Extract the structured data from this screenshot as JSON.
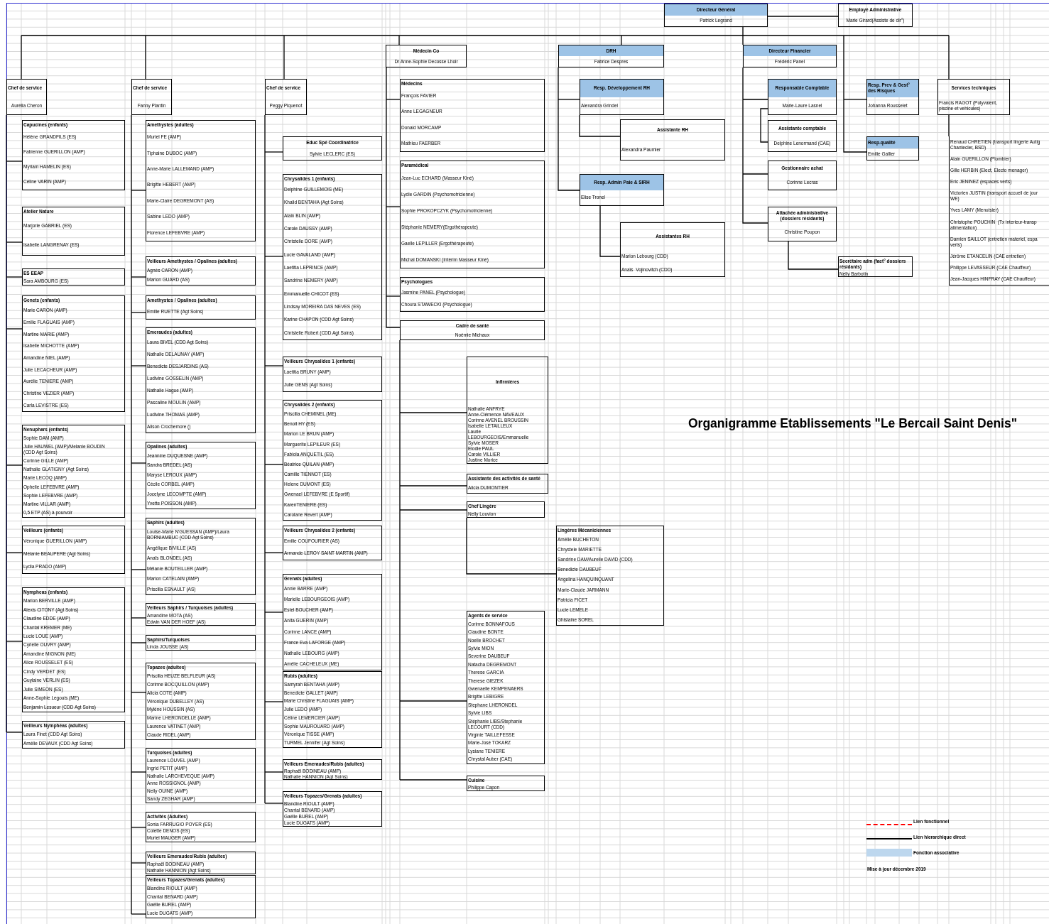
{
  "title": "Organigramme Etablissements \"Le Bercail Saint Denis\"",
  "header": [
    {
      "kind": "post",
      "title": "Directeur Général",
      "associative": true,
      "members": [
        "Patrick Legrand"
      ]
    },
    {
      "kind": "post",
      "title": "Employé Administrative",
      "associative": false,
      "members": [
        "Marie Girard(Assiste de dir°)"
      ]
    }
  ],
  "columns": [
    {
      "boxes": [
        {
          "kind": "chief",
          "title": "Chef de service",
          "associative": false,
          "members": [
            "Aurélia Cheron"
          ]
        },
        {
          "kind": "team",
          "title": "Capucines (enfants)",
          "associative": false,
          "members": [
            "Hélène GRANDFILS (ES)",
            "Fabienne GUERILLON (AMP)",
            "Myriam HAMELIN (ES)",
            "Céline VARIN (AMP)"
          ]
        },
        {
          "kind": "team",
          "title": "Atelier Nature",
          "associative": false,
          "members": [
            "Marjorie GABRIEL (ES)",
            "Isabelle LANGRENAY (ES)"
          ]
        },
        {
          "kind": "team",
          "title": "ES EEAP",
          "associative": false,
          "members": [
            "Sara AMBOURG (ES)"
          ]
        },
        {
          "kind": "team",
          "title": "Genets (enfants)",
          "associative": false,
          "members": [
            "Marie CARON (AMP)",
            "Emilie FLAGUAIS (AMP)",
            "Martine MARIE (AMP)",
            "Isabelle MICHOTTE (AMP)",
            "Amandine NIEL (AMP)",
            "Julie LECACHEUR (AMP)",
            "Aurélie TENIERE (AMP)",
            "Christine VEZIER (AMP)",
            "Carla LEVISTRE (ES)"
          ]
        },
        {
          "kind": "team",
          "title": "Nenuphars (enfants)",
          "associative": false,
          "members": [
            "Sophie DAM (AMP)",
            "Julie HAUWEL (AMP)/Melanie BOUDIN\n(CDD Agt Soins)",
            "Corinne GILLE (AMP)",
            "Nathalie GLATIGNY (Agt Soins)",
            "Marie LECOQ (AMP)",
            "Ophelie LEFEBVRE (AMP)",
            "Sophie LEFEBVRE (AMP)",
            "Martine VILLAR (AMP)",
            "0,5 ETP (AS) à pourvoir"
          ]
        },
        {
          "kind": "team",
          "title": "Veilleurs (enfants)",
          "associative": false,
          "members": [
            "Véronique GUERILLON (AMP)",
            "Mélanie BEAUPERE (Agt Soins)",
            "Lydia PRADO (AMP)"
          ]
        },
        {
          "kind": "team",
          "title": "Nympheas (enfants)",
          "associative": false,
          "members": [
            "Marion BERVILLE (AMP)",
            "Alexis CITONY (Agt Soins)",
            "Claudine EDDE (AMP)",
            "Chantal KREMER (ME)",
            "Lucie LOUE (AMP)",
            "Cyrielle OUVRY (AMP)",
            "Amandine MIGNON (ME)",
            "Alice ROUSSELET (ES)",
            "Cindy VERDET (ES)",
            "Guylaine VERLIN (ES)",
            "Julie SIMEON (ES)",
            "Anne-Sophie Legouis (ME)",
            "Benjamin Lesueur (CDD Agt Soins)"
          ]
        },
        {
          "kind": "team",
          "title": "Veilleurs Nymphéas (adultes)",
          "associative": false,
          "members": [
            "Laura Finet (CDD Agt Soins)",
            "Amélie DEVAUX (CDD Agt Soins)"
          ]
        }
      ]
    },
    {
      "boxes": [
        {
          "kind": "chief",
          "title": "Chef de service",
          "associative": false,
          "members": [
            "Fanny Plantin"
          ]
        },
        {
          "kind": "team",
          "title": "Amethystes (adultes)",
          "associative": false,
          "members": [
            "Muriel FE (AMP)",
            "Tiphaine DUBOC (AMP)",
            "Anne-Marie LALLEMAND (AMP)",
            "Brigitte HEBERT (AMP)",
            "Marie-Claire DEGREMONT (AS)",
            "Sabine LEDO (AMP)",
            "Florence LEFEBVRE (AMP)"
          ]
        },
        {
          "kind": "team",
          "title": "Veilleurs Amethystes / Opalines (adultes)",
          "associative": false,
          "members": [
            "Agnès CARON (AMP)",
            "Marion GUARD (AS)"
          ]
        },
        {
          "kind": "team",
          "title": "Amethystes / Opalines (adultes)",
          "associative": false,
          "members": [
            "Emilie RUETTE (Agt Soins)"
          ]
        },
        {
          "kind": "team",
          "title": "Emeraudes (adultes)",
          "associative": false,
          "members": [
            "Laura BIVEL (CDD Agt Soins)",
            "Nathalie DELAUNAY (AMP)",
            "Benedicte DESJARDINS (AS)",
            "Ludivine GOSSELIN (AMP)",
            "Nathalie Hague (AMP)",
            "Pascaline MOULIN (AMP)",
            "Ludivine THOMAS (AMP)",
            "Alison Crochemore ()"
          ]
        },
        {
          "kind": "team",
          "title": "Opalines (adultes)",
          "associative": false,
          "members": [
            "Jeannine DUQUESNE (AMP)",
            "Sandra BREDEL (AS)",
            "Maryse LEROUX (AMP)",
            "Cécile CORBEL (AMP)",
            "Jocelyne LECOMPTE (AMP)",
            "Yvette POISSON (AMP)"
          ]
        },
        {
          "kind": "team",
          "title": "Saphirs (adultes)",
          "associative": false,
          "members": [
            "Louise-Marie N'GUESSAN (AMP)/Laura\nBORNIAMBUC (CDD Agt Soins)",
            "Angélique BIVILLE (AS)",
            "Anaïs BLONDEL (AS)",
            "Mélanie BOUTEILLER (AMP)",
            "Marion CATELAIN (AMP)",
            "Priscilla ESNAULT (AS)"
          ]
        },
        {
          "kind": "team",
          "title": "Veilleurs Saphirs / Turquoises (adultes)",
          "associative": false,
          "members": [
            "Amandine MOTA (AS)",
            "Edwin VAN DER HOEF (AS)"
          ]
        },
        {
          "kind": "team",
          "title": "Saphirs/Turquoises",
          "associative": false,
          "members": [
            "Linda JOUSSE (AS)"
          ]
        },
        {
          "kind": "team",
          "title": "Topazes (adultes)",
          "associative": false,
          "members": [
            "Priscilla HEUZE BELFLEUR (AS)",
            "Corinne BOCQUILLON (AMP)",
            "Alicia COTE (AMP)",
            "Véronique DUBELLEY (AS)",
            "Mylène HOUSSIN (AS)",
            "Marine LHERONDELLE (AMP)",
            "Laurence VATINET (AMP)",
            "Claude RIDEL (AMP)"
          ]
        },
        {
          "kind": "team",
          "title": "Turquoises (adultes)",
          "associative": false,
          "members": [
            "Laurence LOUVEL (AMP)",
            "Ingrid PETIT (AMP)",
            "Nathalie LARCHEVEQUE (AMP)",
            "Anne ROSSIGNOL (AMP)",
            "Nelly OUINE (AMP)",
            "Sandy ZEGHAR (AMP)"
          ]
        },
        {
          "kind": "team",
          "title": "Activités (Adultes)",
          "associative": false,
          "members": [
            "Sonia FARRUGIO POYER (ES)",
            "Colette DENOS (ES)",
            "Muriel MAUGER (AMP)"
          ]
        },
        {
          "kind": "team",
          "title": "Veilleurs Emeraudes/Rubis (adultes)",
          "associative": false,
          "members": [
            "Raphaël BODINEAU (AMP)",
            "Nathalie HANNION (Agt Soins)"
          ]
        },
        {
          "kind": "team",
          "title": "Veilleurs Topazes/Grenats (adultes)",
          "associative": false,
          "members": [
            "Blandine RIOULT (AMP)",
            "Chantal BENARD (AMP)",
            "Gaëlle BUREL (AMP)",
            "Lucie DUGATS (AMP)"
          ]
        }
      ]
    },
    {
      "boxes": [
        {
          "kind": "chief",
          "title": "Chef de service",
          "associative": false,
          "members": [
            "Peggy Piquenot"
          ]
        },
        {
          "kind": "post",
          "title": "Educ Spé Coordinatrice",
          "associative": false,
          "members": [
            "Sylvie LECLERC (ES)"
          ]
        },
        {
          "kind": "team",
          "title": "Chrysalides 1 (enfants)",
          "associative": false,
          "members": [
            "Delphine GUILLEMOIS (ME)",
            "Khalid BENTAHA (Agt Soins)",
            "Alain BLIN (AMP)",
            "Carole DAUSSY (AMP)",
            "Christelle DORE (AMP)",
            "Lucie GAVALAND (AMP)",
            "Laetitia LEPRINCE (AMP)",
            "Sandrine NEMERY (AMP)",
            "Emmanuelle CHICOT (ES)",
            "Lindsay MOREIRA DAS NEVES (ES)",
            "Karine CHAPON (CDD Agt Soins)",
            "Christelle Robert (CDD Agt Soins)"
          ]
        },
        {
          "kind": "team",
          "title": "Veilleurs Chrysalides 1 (enfants)",
          "associative": false,
          "members": [
            "Laetitia BRUNY (AMP)",
            "Julie GENS (Agt Soins)"
          ]
        },
        {
          "kind": "team",
          "title": "Chrysalides 2 (enfants)",
          "associative": false,
          "members": [
            "Priscilla CHEMINEL (ME)",
            "Benoit HY (ES)",
            "Marion LE BRUN (AMP)",
            "Marguerite LEPILEUR (ES)",
            "Fabiola ANQUETIL (ES)",
            "Béatrice QUILAN (AMP)",
            "Camille TIENNOT (ES)",
            "Helene DUMONT (ES)",
            "Gwenael LEFEBVRE (E Sportif)",
            "KarenTENIERE (ES)",
            "Carolane Revert (AMP)"
          ]
        },
        {
          "kind": "team",
          "title": "Veilleurs Chrysalides 2 (enfants)",
          "associative": false,
          "members": [
            "Emilie COUFOURIER (AS)",
            "Armande LEROY SAINT MARTIN (AMP)"
          ]
        },
        {
          "kind": "team",
          "title": "Grenats (adultes)",
          "associative": false,
          "members": [
            "Annie BARRE (AMP)",
            "Marielle LEBOURGEOIS (AMP)",
            "Estel BOUCHER (AMP)",
            "Anita GUERIN (AMP)",
            "Corinne LANCE (AMP)",
            "France Eva LAFORGE (AMP)",
            "Nathalie LEBOURG (AMP)",
            "Amélie CACHELEUX (ME)"
          ]
        },
        {
          "kind": "team",
          "title": "Rubis (adultes)",
          "associative": false,
          "members": [
            "Samyrah BENTAHA (AMP)",
            "Benedicte GALLET (AMP)",
            "Marie Christine FLAGUAIS (AMP)",
            "Julie LEDO (AMP)",
            "Céline LEMERCIER (AMP)",
            "Sophie MAUROUARD (AMP)",
            "Véronique TISSE (AMP)",
            "TURMEL Jennifer (Agt Soins)"
          ]
        },
        {
          "kind": "team",
          "title": "Veilleurs Emeraudes/Rubis (adultes)",
          "associative": false,
          "members": [
            "Raphaël BODINEAU (AMP)",
            "Nathalie HANNION (Agt Soins)"
          ]
        },
        {
          "kind": "team",
          "title": "Veilleurs Topazes/Grenats (adultes)",
          "associative": false,
          "members": [
            "Blandine RIOULT (AMP)",
            "Chantal BENARD (AMP)",
            "Gaëlle BUREL (AMP)",
            "Lucie DUGATS (AMP)"
          ]
        }
      ]
    },
    {
      "boxes": [
        {
          "kind": "post",
          "title": "Médecin Co",
          "associative": false,
          "members": [
            "Dr Anne-Sophie Decosse Lhoir"
          ]
        },
        {
          "kind": "team",
          "title": "Médecins",
          "associative": false,
          "members": [
            "François FAVIER",
            "Anne LEGAGNEUR",
            "Donald MORCAMP",
            "Mathieu FAERBER"
          ]
        },
        {
          "kind": "team",
          "title": "Paramédical",
          "associative": false,
          "members": [
            "Jean-Luc ECHARD (Masseur Kiné)",
            "Lydie GARDIN (Psychomotricienne)",
            "Sophie PROKOPCZYK (Psychomotricienne)",
            "Stéphanie NEMERY(Ergothérapeute)",
            "Gaelle LEPILLER (Ergothérapeute)",
            "Michal DOMANSKI (Intérim Masseur Kiné)"
          ]
        },
        {
          "kind": "team",
          "title": "Psychologues",
          "associative": false,
          "members": [
            "Jasmine PANEL (Psychologue)",
            "Choura STAWECKI (Psychologue)"
          ]
        },
        {
          "kind": "post",
          "title": "Cadre de santé",
          "associative": false,
          "members": [
            "Noémie Michaux"
          ]
        },
        {
          "kind": "unit",
          "title": "Infirmières",
          "associative": false,
          "members": [
            "Nathalie ANFRYE",
            "Anne-Clémence NAVEAUX",
            "Corinne AVENEL BROUSSIN",
            "Isabelle LETAILLEUX",
            "Laurie\nLEBOURGEOIS/Emmanuelle",
            "Sylvie MOSER",
            "Elodie PAUL",
            "Carole VILLIER",
            "Justine Morice"
          ]
        },
        {
          "kind": "team",
          "title": "Assistante des activités de santé",
          "associative": false,
          "members": [
            "Alicia DUMONTIER"
          ]
        },
        {
          "kind": "team",
          "title": "Chef Lingère",
          "associative": false,
          "members": [
            "Nelly Louvion"
          ]
        },
        {
          "kind": "team",
          "title": "Lingères Mécaniciennes",
          "associative": false,
          "members": [
            "Amélie BUCHETON",
            "Chrystele MARIETTE",
            "Sandrine DAM/Aurelie DAVID (CDD)",
            "Benedicte DAUBEUF",
            "Angelina HANQUINQUANT",
            "Marie-Claude JARMANN",
            "Patricia FICET",
            "Lucie LEMELE",
            "Ghislaine SOREL"
          ]
        },
        {
          "kind": "team",
          "title": "Agents de service",
          "associative": false,
          "members": [
            "Corinne BONNAFOUS",
            "Claudine BONTE",
            "Noelle BROCHET",
            "Sylvie MION",
            "Severine DAUBEUF",
            "Natacha DEGREMONT",
            "Therese GARCIA",
            "Therese GIEZEK",
            "Gwenaelle KEMPENAERS",
            "Brigitte LEBIGRE",
            "Stephane LHERONDEL",
            "Sylvie LIBS",
            "Stéphanie LIBS/Stephanie\nLECOURT (CDD)",
            "Virginie TAILLEFESSE",
            "Marie-José TOKARZ",
            "Lysiane TENIERE",
            "Chrystal Auber (CAE)"
          ]
        },
        {
          "kind": "team",
          "title": "Cuisine",
          "associative": false,
          "members": [
            "Philippe Capon"
          ]
        }
      ]
    },
    {
      "boxes": [
        {
          "kind": "post",
          "title": "DRH",
          "associative": true,
          "members": [
            "Fabrice Despres"
          ]
        },
        {
          "kind": "unit",
          "title": "Resp. Développement RH",
          "associative": true,
          "members": [
            "Alexandra Grindel"
          ]
        },
        {
          "kind": "unit",
          "title": "Assistante RH",
          "associative": false,
          "members": [
            "Alexandra Paumier"
          ]
        },
        {
          "kind": "unit",
          "title": "Resp. Admin Paie & SIRH",
          "associative": true,
          "members": [
            "Elise Tronel"
          ]
        },
        {
          "kind": "unit",
          "title": "Assistantes RH",
          "associative": false,
          "members": [
            "Marion Lebourg (CDD)",
            "Anaïs  Vojinovitch (CDD)"
          ]
        }
      ]
    },
    {
      "boxes": [
        {
          "kind": "post",
          "title": "Directeur Financier",
          "associative": true,
          "members": [
            "Frédéric Panel"
          ]
        },
        {
          "kind": "post",
          "title": "Responsable Comptable",
          "associative": true,
          "members": [
            "Marie-Laure Lasnel"
          ]
        },
        {
          "kind": "post",
          "title": "Assistante comptable",
          "associative": false,
          "members": [
            "Delphine Lenormand (CAE)"
          ]
        },
        {
          "kind": "post",
          "title": "Gestionnaire achat",
          "associative": false,
          "members": [
            "Corinne Lecras"
          ]
        },
        {
          "kind": "post",
          "title": "Attachée administrative\n(dossiers résidants)",
          "associative": false,
          "members": [
            "Christine Poupon"
          ]
        },
        {
          "kind": "team",
          "title": "Secrétaire adm (fact° dossiers\nrésidants)",
          "associative": false,
          "members": [
            "Nelly Barbotin"
          ]
        }
      ]
    },
    {
      "boxes": [
        {
          "kind": "team",
          "title": "Resp. Prev & Gest°\ndes Risques",
          "associative": true,
          "members": [
            "Johanna Rousselet"
          ]
        },
        {
          "kind": "team",
          "title": "Resp.qualité",
          "associative": true,
          "members": [
            "Emilie Gallier"
          ]
        }
      ]
    },
    {
      "boxes": [
        {
          "kind": "unit",
          "title": "Services techniques",
          "associative": false,
          "members": [
            "Francis RAGOT (Polyvalent,\npiscine et vehicules)"
          ]
        },
        {
          "kind": "list",
          "members": [
            "Renaud CHRETIEN (transport lingerie Autig\nChantecler, BSD)",
            "Alain GUERILLON (Plombier)",
            "Gille HERBIN (Elect, Electo menager)",
            "Eric JENINEZ (espaces verts)",
            "Victorien JUSTIN (transport accueil de jour\nWE)",
            "Yves LAMY (Menuisier)",
            "Christophe POUCHIN  (Tx interieur-transp\nalimentation)",
            "Damien SAILLOT (entretien materiel, espa\nverts)",
            "Jérôme ETANCELIN (CAE entretien)",
            "Philippe LEVASSEUR (CAE Chauffeur)",
            "Jean-Jacques HINFRAY (CAE Chauffeur)"
          ]
        }
      ]
    }
  ],
  "legend": [
    {
      "kind": "dashed",
      "label": "Lien fonctionnel"
    },
    {
      "kind": "solid",
      "label": "Lien hierarchique direct"
    },
    {
      "kind": "fill",
      "label": "Fonction associative"
    }
  ],
  "update_note": "Mise à jour décembre 2019"
}
